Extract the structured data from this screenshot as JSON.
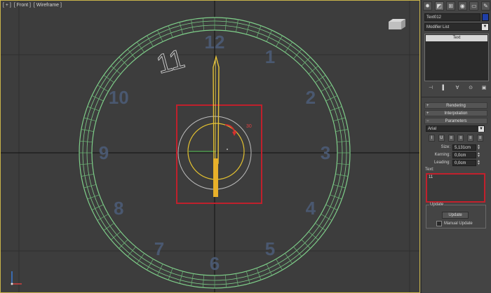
{
  "viewport": {
    "label_parts": [
      "[ + ]",
      "[ Front ]",
      "[ Wireframe ]"
    ],
    "clock_numerals": [
      "11",
      "12",
      "1",
      "2",
      "3",
      "4",
      "5",
      "6",
      "7",
      "8",
      "9",
      "10"
    ],
    "angle_readout": "30"
  },
  "panel": {
    "tabs": [
      {
        "icon": "create-icon",
        "glyph": "✹"
      },
      {
        "icon": "modify-icon",
        "glyph": "◩"
      },
      {
        "icon": "hierarchy-icon",
        "glyph": "⊞"
      },
      {
        "icon": "motion-icon",
        "glyph": "◉"
      },
      {
        "icon": "display-icon",
        "glyph": "▭"
      },
      {
        "icon": "utilities-icon",
        "glyph": "✎"
      }
    ],
    "object_name": "Text012",
    "object_color": "#1f3fa8",
    "modifier_list": "Modifier List",
    "stack_items": [
      "Text"
    ],
    "stack_buttons": [
      "⊣",
      "▌",
      "∀",
      "⊙",
      "▣"
    ],
    "rollouts": {
      "rendering": "Rendering",
      "interpolation": "Interpolation",
      "parameters": "Parameters"
    },
    "font": "Arial",
    "format_buttons": [
      "I",
      "U",
      "≡",
      "≡",
      "≡",
      "≡"
    ],
    "size": {
      "label": "Size:",
      "value": "5,131cm"
    },
    "kerning": {
      "label": "Kerning:",
      "value": "0,0cm"
    },
    "leading": {
      "label": "Leading:",
      "value": "0,0cm"
    },
    "text_label": "Text:",
    "text_value": "11",
    "update_label": "Update",
    "update_button": "Update",
    "manual_update": "Manual Update"
  }
}
